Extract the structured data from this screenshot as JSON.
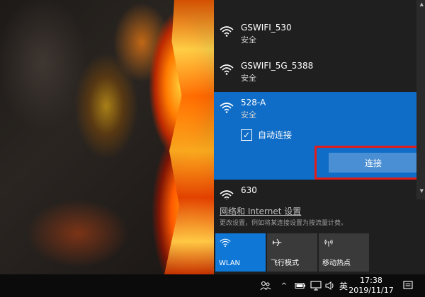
{
  "networks": [
    {
      "ssid": "GSWIFI_530",
      "security": "安全"
    },
    {
      "ssid": "GSWIFI_5G_5388",
      "security": "安全"
    },
    {
      "ssid": "528-A",
      "security": "安全",
      "selected": true,
      "auto_connect_label": "自动连接",
      "auto_connect_checked": true,
      "connect_label": "连接"
    },
    {
      "ssid": "630"
    }
  ],
  "settings": {
    "link": "网络和 Internet 设置",
    "desc": "更改设置，例如将某连接设置为按流量计费。"
  },
  "quick_actions": [
    {
      "label": "WLAN",
      "icon": "wifi-icon",
      "active": true
    },
    {
      "label": "飞行模式",
      "icon": "airplane-icon",
      "active": false
    },
    {
      "label": "移动热点",
      "icon": "hotspot-icon",
      "active": false
    }
  ],
  "taskbar": {
    "ime": "英",
    "time": "17:38",
    "date": "2019/11/17"
  },
  "colors": {
    "accent": "#0f6dc7",
    "highlight": "#e21b1b",
    "flyout_bg": "#1f1f1f"
  }
}
